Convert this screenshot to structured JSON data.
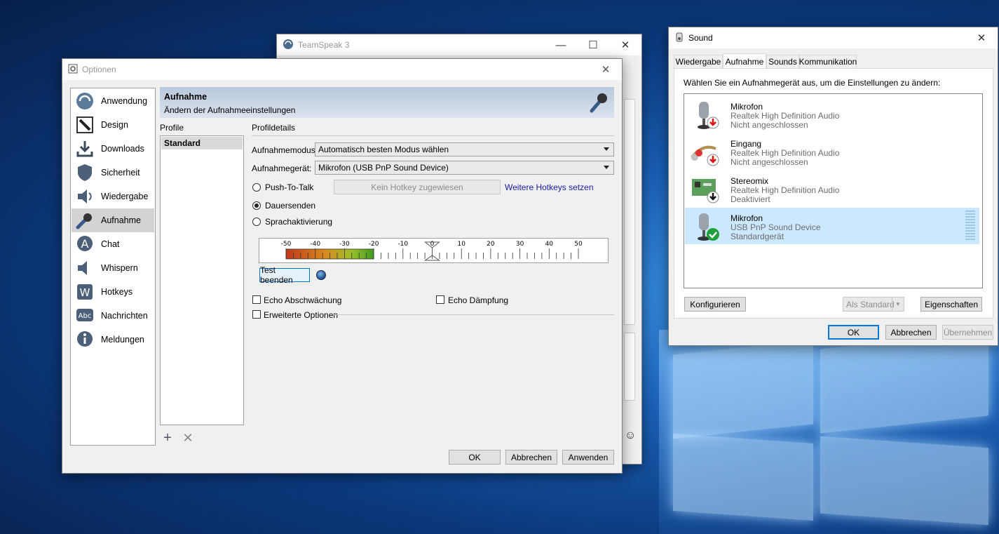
{
  "teamspeak": {
    "title": "TeamSpeak 3"
  },
  "options": {
    "title": "Optionen",
    "nav": [
      {
        "label": "Anwendung",
        "icon": "teamspeak-icon"
      },
      {
        "label": "Design",
        "icon": "brush-icon"
      },
      {
        "label": "Downloads",
        "icon": "download-icon"
      },
      {
        "label": "Sicherheit",
        "icon": "shield-icon"
      },
      {
        "label": "Wiedergabe",
        "icon": "speaker-icon"
      },
      {
        "label": "Aufnahme",
        "icon": "microphone-icon"
      },
      {
        "label": "Chat",
        "icon": "chat-icon"
      },
      {
        "label": "Whispern",
        "icon": "whisper-icon"
      },
      {
        "label": "Hotkeys",
        "icon": "hotkeys-icon"
      },
      {
        "label": "Nachrichten",
        "icon": "messages-icon"
      },
      {
        "label": "Meldungen",
        "icon": "info-icon"
      }
    ],
    "active_nav": "Aufnahme",
    "header": {
      "title": "Aufnahme",
      "subtitle": "Ändern der Aufnahmeeinstellungen"
    },
    "profile_label": "Profile",
    "profiles": [
      "Standard"
    ],
    "details_label": "Profildetails",
    "mode_label": "Aufnahmemodus:",
    "mode_value": "Automatisch besten Modus wählen",
    "device_label": "Aufnahmegerät:",
    "device_value": "Mikrofon (USB PnP Sound Device)",
    "ptt_label": "Push-To-Talk",
    "hotkey_button": "Kein Hotkey zugewiesen",
    "more_hotkeys": "Weitere Hotkeys setzen",
    "continuous_label": "Dauersenden",
    "voice_activation_label": "Sprachaktivierung",
    "selected_mode": "Dauersenden",
    "meter": {
      "ticks": [
        "-50",
        "-40",
        "-30",
        "-20",
        "-10",
        "0",
        "10",
        "20",
        "30",
        "40",
        "50"
      ],
      "level_db": -20,
      "threshold_db": 0
    },
    "test_button": "Test beenden",
    "echo_reduction": "Echo Abschwächung",
    "echo_cancel": "Echo Dämpfung",
    "advanced": "Erweiterte Optionen",
    "ok": "OK",
    "cancel": "Abbrechen",
    "apply": "Anwenden"
  },
  "sound": {
    "title": "Sound",
    "tabs": [
      "Wiedergabe",
      "Aufnahme",
      "Sounds",
      "Kommunikation"
    ],
    "active_tab": "Aufnahme",
    "instruction": "Wählen Sie ein Aufnahmegerät aus, um die Einstellungen zu ändern:",
    "devices": [
      {
        "name": "Mikrofon",
        "driver": "Realtek High Definition Audio",
        "status": "Nicht angeschlossen",
        "icon": "microphone-device-icon",
        "badge": "red-arrow-down-icon"
      },
      {
        "name": "Eingang",
        "driver": "Realtek High Definition Audio",
        "status": "Nicht angeschlossen",
        "icon": "line-in-icon",
        "badge": "red-arrow-down-icon"
      },
      {
        "name": "Stereomix",
        "driver": "Realtek High Definition Audio",
        "status": "Deaktiviert",
        "icon": "sound-card-icon",
        "badge": "black-arrow-down-icon"
      },
      {
        "name": "Mikrofon",
        "driver": "USB PnP Sound Device",
        "status": "Standardgerät",
        "icon": "microphone-device-icon",
        "badge": "green-check-icon"
      }
    ],
    "selected_device": 3,
    "configure": "Konfigurieren",
    "set_default": "Als Standard",
    "properties": "Eigenschaften",
    "ok": "OK",
    "cancel": "Abbrechen",
    "apply": "Übernehmen"
  }
}
